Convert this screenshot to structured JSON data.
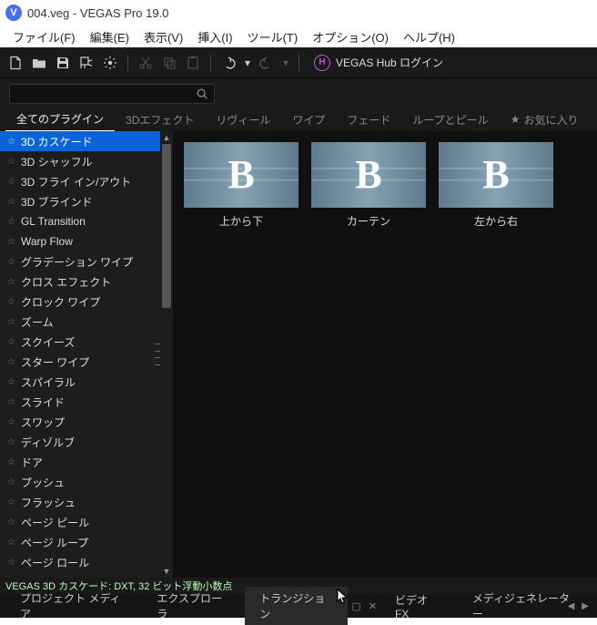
{
  "titlebar": {
    "file": "004.veg",
    "app": "VEGAS Pro 19.0"
  },
  "menubar": [
    "ファイル(F)",
    "編集(E)",
    "表示(V)",
    "挿入(I)",
    "ツール(T)",
    "オプション(O)",
    "ヘルプ(H)"
  ],
  "toolbar": {
    "hub_label": "VEGAS Hub ログイン"
  },
  "plugin_tabs": {
    "items": [
      "全てのプラグイン",
      "3Dエフェクト",
      "リヴィール",
      "ワイプ",
      "フェード",
      "ループとピール"
    ],
    "active": 0,
    "favorites_label": "お気に入り"
  },
  "plugins": [
    "3D カスケード",
    "3D シャッフル",
    "3D フライ イン/アウト",
    "3D ブラインド",
    "GL Transition",
    "Warp Flow",
    "グラデーション ワイプ",
    "クロス エフェクト",
    "クロック ワイプ",
    "ズーム",
    "スクイーズ",
    "スター ワイプ",
    "スパイラル",
    "スライド",
    "スワップ",
    "ディゾルブ",
    "ドア",
    "プッシュ",
    "フラッシュ",
    "ページ ピール",
    "ページ ループ",
    "ページ ロール"
  ],
  "plugins_selected": 0,
  "thumbs": [
    {
      "label": "上から下",
      "letter": "B"
    },
    {
      "label": "カーテン",
      "letter": "B"
    },
    {
      "label": "左から右",
      "letter": "B"
    }
  ],
  "status": "VEGAS 3D カスケード: DXT, 32 ビット浮動小数点",
  "bottom_tabs": {
    "items": [
      "プロジェクト メディア",
      "エクスプローラ",
      "トランジション",
      "ビデオ FX",
      "メディジェネレーター"
    ],
    "active": 2
  }
}
